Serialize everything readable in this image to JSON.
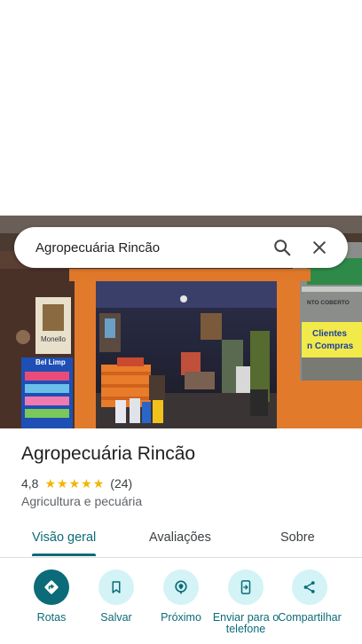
{
  "search": {
    "query": "Agropecuária Rincão"
  },
  "photo": {
    "signs": {
      "monello_brand": "Monello",
      "bel_limp_brand": "Bel Limp",
      "banner_top": "NTO COBERTO",
      "banner_line1": "Clientes",
      "banner_line2": "n Compras"
    }
  },
  "place": {
    "name": "Agropecuária Rincão",
    "rating": "4,8",
    "stars": 4.8,
    "reviews": "(24)",
    "category": "Agricultura e pecuária"
  },
  "tabs": [
    {
      "label": "Visão geral",
      "active": true
    },
    {
      "label": "Avaliações",
      "active": false
    },
    {
      "label": "Sobre",
      "active": false
    }
  ],
  "actions": [
    {
      "label": "Rotas",
      "icon": "directions-icon"
    },
    {
      "label": "Salvar",
      "icon": "bookmark-icon"
    },
    {
      "label": "Próximo",
      "icon": "nearby-icon"
    },
    {
      "label": "Enviar para o telefone",
      "icon": "send-to-phone-icon"
    },
    {
      "label": "Compartilhar",
      "icon": "share-icon"
    }
  ],
  "colors": {
    "accent": "#0b6b78",
    "action_bg": "#d3f3f6",
    "star": "#f4b400"
  }
}
